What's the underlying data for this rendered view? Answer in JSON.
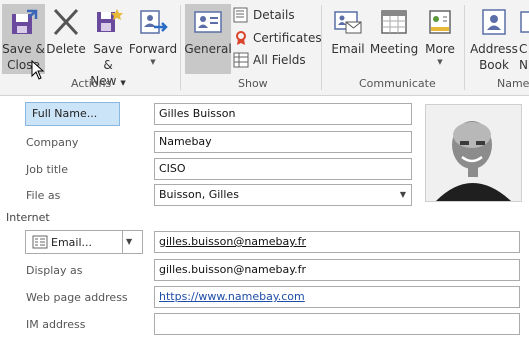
{
  "ribbon": {
    "actions": {
      "label": "Actions",
      "save_close": [
        "Save &",
        "Close"
      ],
      "delete": "Delete",
      "save_new": [
        "Save &",
        "New"
      ],
      "forward": "Forward"
    },
    "show": {
      "label": "Show",
      "general": "General",
      "details": "Details",
      "certificates": "Certificates",
      "all_fields": "All Fields"
    },
    "communicate": {
      "label": "Communicate",
      "email": "Email",
      "meeting": "Meeting",
      "more": "More"
    },
    "names": {
      "label": "Names",
      "address_book": [
        "Address",
        "Book"
      ],
      "check_names": [
        "C",
        "N"
      ]
    }
  },
  "form": {
    "full_name_button": "Full Name...",
    "full_name_value": "Gilles Buisson",
    "company_label": "Company",
    "company_value": "Namebay",
    "job_title_label": "Job title",
    "job_title_value": "CISO",
    "file_as_label": "File as",
    "file_as_value": "Buisson, Gilles",
    "internet_heading": "Internet",
    "email_button": "Email...",
    "email_value": "gilles.buisson@namebay.fr",
    "display_as_label": "Display as",
    "display_as_value": "gilles.buisson@namebay.fr",
    "web_label": "Web page address",
    "web_value": "https://www.namebay.com",
    "im_label": "IM address",
    "im_value": ""
  },
  "colors": {
    "accent": "#5b6ea8",
    "link": "#1f4ea8",
    "selected_button_bg": "#cce4f7",
    "active_ribbon_bg": "#c8c8c8"
  }
}
